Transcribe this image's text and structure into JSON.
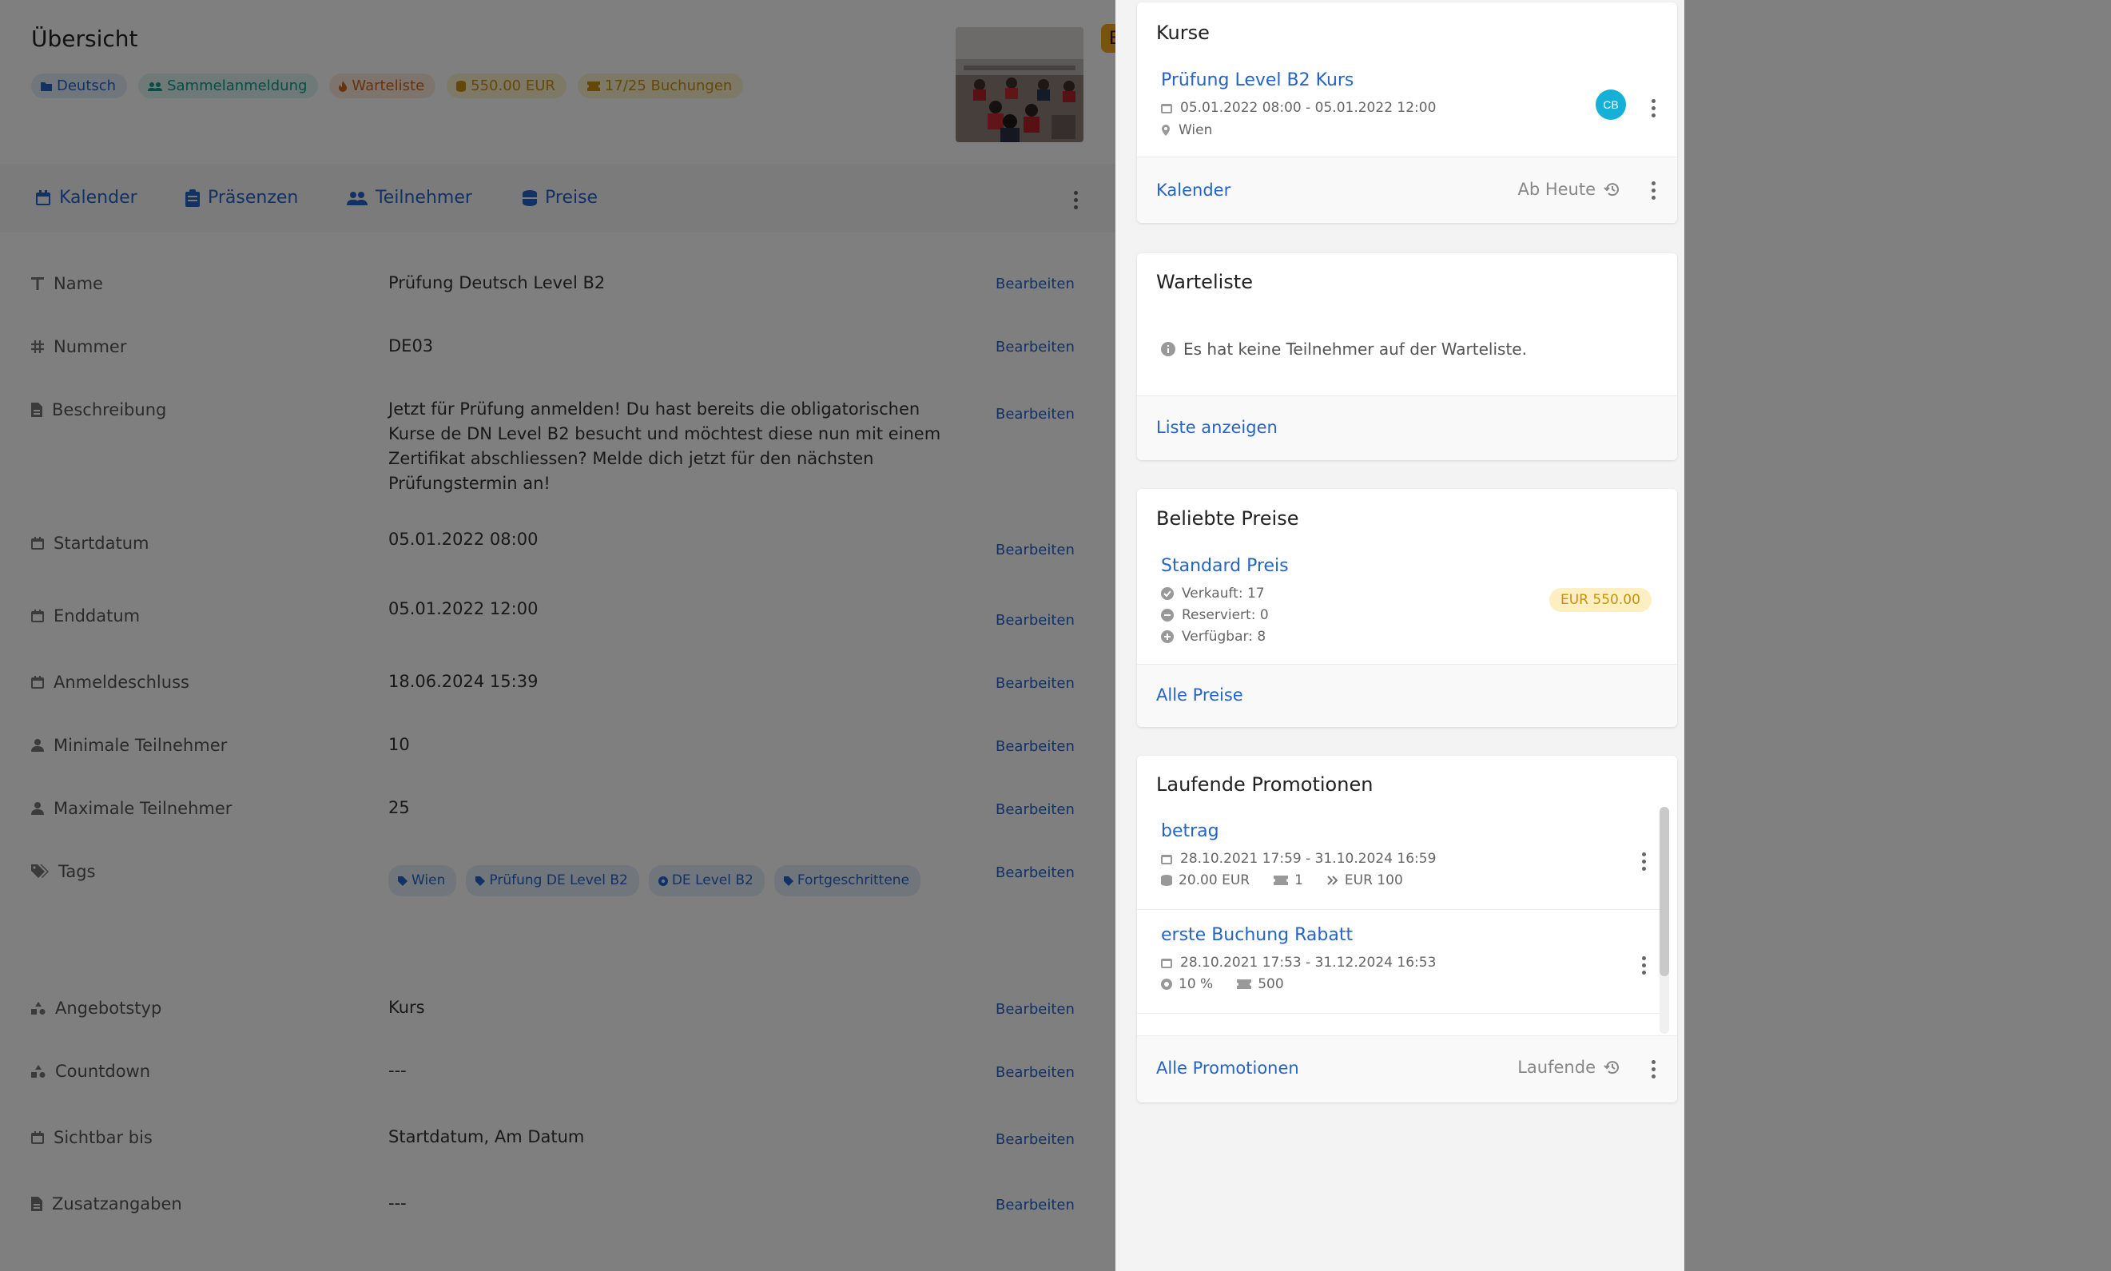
{
  "overview": {
    "title": "Übersicht",
    "badges": [
      {
        "label": "Deutsch",
        "icon": "folder-icon"
      },
      {
        "label": "Sammelanmeldung",
        "icon": "group-icon"
      },
      {
        "label": "Warteliste",
        "icon": "fire-icon"
      },
      {
        "label": "550.00 EUR",
        "icon": "coins-icon"
      },
      {
        "label": "17/25 Buchungen",
        "icon": "ticket-icon"
      }
    ],
    "thumbnail_badge": "B"
  },
  "tabs": [
    {
      "label": "Kalender",
      "icon": "calendar-icon"
    },
    {
      "label": "Präsenzen",
      "icon": "clipboard-icon"
    },
    {
      "label": "Teilnehmer",
      "icon": "users-icon"
    },
    {
      "label": "Preise",
      "icon": "coins-icon"
    }
  ],
  "edit_label": "Bearbeiten",
  "fields": [
    {
      "label": "Name",
      "value": "Prüfung Deutsch Level B2"
    },
    {
      "label": "Nummer",
      "value": "DE03"
    },
    {
      "label": "Beschreibung",
      "value": "Jetzt für Prüfung anmelden! Du hast bereits die obligatorischen Kurse de DN Level B2 besucht und möchtest diese nun mit einem Zertifikat abschliessen? Melde dich jetzt für den nächsten Prüfungstermin an!"
    },
    {
      "label": "Startdatum",
      "value": "05.01.2022 08:00"
    },
    {
      "label": "Enddatum",
      "value": "05.01.2022 12:00"
    },
    {
      "label": "Anmeldeschluss",
      "value": "18.06.2024 15:39"
    },
    {
      "label": "Minimale Teilnehmer",
      "value": "10"
    },
    {
      "label": "Maximale Teilnehmer",
      "value": "25"
    },
    {
      "label": "Tags",
      "value": ""
    },
    {
      "label": "Angebotstyp",
      "value": "Kurs"
    },
    {
      "label": "Countdown",
      "value": "---"
    },
    {
      "label": "Sichtbar bis",
      "value": "Startdatum, Am Datum"
    },
    {
      "label": "Zusatzangaben",
      "value": "---"
    }
  ],
  "tags": [
    "Wien",
    "Prüfung DE Level B2",
    "DE Level B2",
    "Fortgeschrittene"
  ],
  "drawer": {
    "kurse": {
      "title": "Kurse",
      "course_title": "Prüfung Level B2 Kurs",
      "course_dates": "05.01.2022 08:00 - 05.01.2022 12:00",
      "course_location": "Wien",
      "avatar_initials": "CB",
      "footer_link": "Kalender",
      "footer_filter": "Ab Heute"
    },
    "warteliste": {
      "title": "Warteliste",
      "info": "Es hat keine Teilnehmer auf der Warteliste.",
      "footer_link": "Liste anzeigen"
    },
    "preise": {
      "title": "Beliebte Preise",
      "price_title": "Standard Preis",
      "sold": "Verkauft: 17",
      "reserved": "Reserviert: 0",
      "available": "Verfügbar: 8",
      "price": "EUR 550.00",
      "footer_link": "Alle Preise"
    },
    "promotionen": {
      "title": "Laufende Promotionen",
      "items": [
        {
          "title": "betrag",
          "dates": "28.10.2021 17:59 - 31.10.2024 16:59",
          "value": "20.00 EUR",
          "count": "1",
          "min": "EUR 100"
        },
        {
          "title": "erste Buchung Rabatt",
          "dates": "28.10.2021 17:53 - 31.12.2024 16:53",
          "value": "10 %",
          "count": "500"
        }
      ],
      "footer_link": "Alle Promotionen",
      "footer_filter": "Laufende"
    }
  }
}
